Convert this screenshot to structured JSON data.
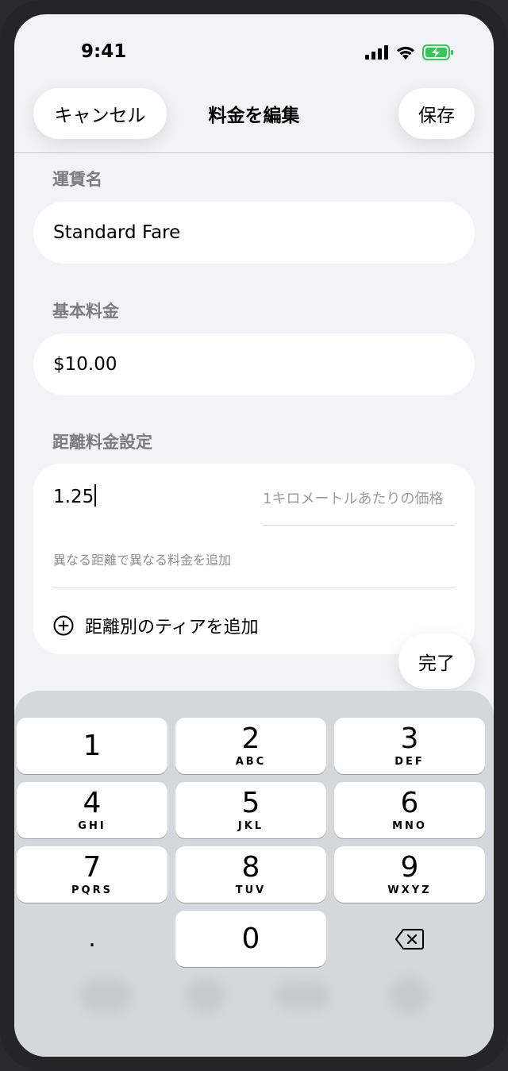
{
  "status_bar": {
    "time": "9:41"
  },
  "nav": {
    "cancel_label": "キャンセル",
    "title": "料金を編集",
    "save_label": "保存"
  },
  "fare_name": {
    "label": "運賃名",
    "value": "Standard Fare"
  },
  "base_fare": {
    "label": "基本料金",
    "value": "$10.00"
  },
  "distance": {
    "label": "距離料金設定",
    "rate_value": "1.25",
    "rate_placeholder": "1キロメートルあたりの価格",
    "note": "異なる距離で異なる料金を追加",
    "add_tier_label": "距離別のティアを追加"
  },
  "done_label": "完了",
  "keypad": {
    "keys": [
      {
        "num": "1",
        "letters": ""
      },
      {
        "num": "2",
        "letters": "ABC"
      },
      {
        "num": "3",
        "letters": "DEF"
      },
      {
        "num": "4",
        "letters": "GHI"
      },
      {
        "num": "5",
        "letters": "JKL"
      },
      {
        "num": "6",
        "letters": "MNO"
      },
      {
        "num": "7",
        "letters": "PQRS"
      },
      {
        "num": "8",
        "letters": "TUV"
      },
      {
        "num": "9",
        "letters": "WXYZ"
      },
      {
        "num": ".",
        "letters": ""
      },
      {
        "num": "0",
        "letters": ""
      }
    ],
    "delete_icon": "delete-backspace-icon"
  },
  "colors": {
    "battery": "#34c759",
    "background": "#f2f2f7",
    "keyboard": "#d6d7dc"
  }
}
